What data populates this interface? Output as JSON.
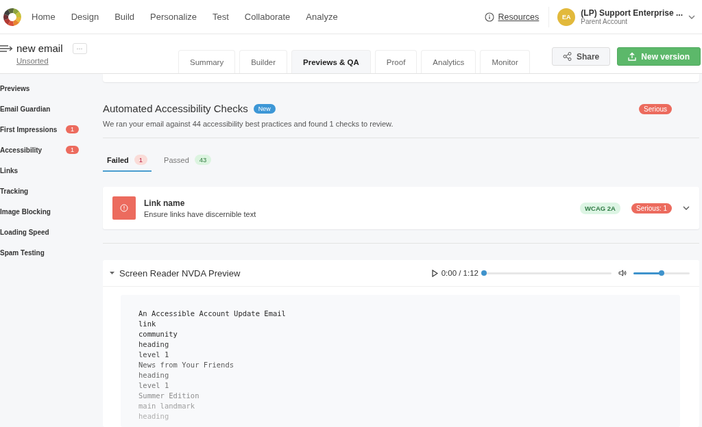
{
  "nav": {
    "items": [
      {
        "label": "Home"
      },
      {
        "label": "Design"
      },
      {
        "label": "Build"
      },
      {
        "label": "Personalize"
      },
      {
        "label": "Test"
      },
      {
        "label": "Collaborate"
      },
      {
        "label": "Analyze"
      }
    ],
    "resources": "Resources",
    "account": {
      "initials": "EA",
      "name": "(LP) Support Enterprise ...",
      "role": "Parent Account"
    }
  },
  "email": {
    "title": "new email",
    "more": "···",
    "folder": "Unsorted"
  },
  "tabs": [
    {
      "label": "Summary",
      "selected": false
    },
    {
      "label": "Builder",
      "selected": false
    },
    {
      "label": "Previews & QA",
      "selected": true
    },
    {
      "label": "Proof",
      "selected": false
    },
    {
      "label": "Analytics",
      "selected": false
    },
    {
      "label": "Monitor",
      "selected": false
    }
  ],
  "actions": {
    "share": "Share",
    "new_version": "New version"
  },
  "sidebar": {
    "items": [
      {
        "label": "Previews"
      },
      {
        "label": "Email Guardian"
      },
      {
        "label": "First Impressions",
        "badge": "1"
      },
      {
        "label": "Accessibility",
        "badge": "1"
      },
      {
        "label": "Links"
      },
      {
        "label": "Tracking"
      },
      {
        "label": "Image Blocking"
      },
      {
        "label": "Loading Speed"
      },
      {
        "label": "Spam Testing"
      }
    ]
  },
  "checks": {
    "title": "Automated Accessibility Checks",
    "title_badge": "New",
    "severity": "Serious",
    "summary": "We ran your email against 44 accessibility best practices and found 1 checks to review.",
    "filters": [
      {
        "label": "Failed",
        "count": "1",
        "kind": "failed",
        "selected": true
      },
      {
        "label": "Passed",
        "count": "43",
        "kind": "passed",
        "selected": false
      }
    ],
    "results": [
      {
        "title": "Link name",
        "description": "Ensure links have discernible text",
        "standard": "WCAG 2A",
        "severity": "Serious: 1",
        "expanded": false
      }
    ]
  },
  "preview": {
    "title": "Screen Reader NVDA Preview",
    "expanded": true,
    "time": "0:00 / 1:12",
    "progress": {
      "level": 0.0
    },
    "volume": {
      "level": 0.5
    },
    "lines": [
      "An Accessible Account Update Email",
      "link",
      "community",
      "heading",
      "level 1",
      "News from Your Friends",
      "heading",
      "level 1",
      "Summer Edition",
      "main landmark",
      "heading"
    ]
  }
}
